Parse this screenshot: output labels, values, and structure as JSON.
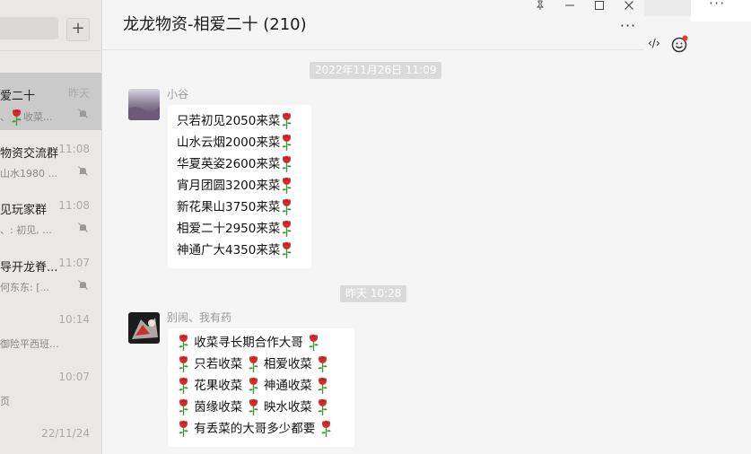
{
  "sidebar": {
    "add_label": "+",
    "conversations": [
      {
        "title": "爱二十",
        "time": "昨天",
        "preview": "收菜...",
        "active": true
      },
      {
        "title": "物资交流群",
        "time": "11:08",
        "preview": "山水1980 ..."
      },
      {
        "title": "见玩家群",
        "time": "11:08",
        "preview": "、: 初见, ..."
      },
      {
        "title": "导开龙脊...",
        "time": "11:07",
        "preview": "何东东: [..."
      },
      {
        "title": "",
        "time": "10:14",
        "preview": "御险平西班..."
      },
      {
        "title": "",
        "time": "10:07",
        "preview": "页"
      },
      {
        "title": "",
        "time": "22/11/24",
        "preview": ""
      }
    ]
  },
  "chat": {
    "title": "龙龙物资-相爱二十 (210)",
    "window_controls": {
      "pin": "⊥",
      "minimize": "—",
      "maximize": "□",
      "close": "✕"
    },
    "more": "···",
    "messages": [
      {
        "time": "2022年11月26日 11:09",
        "sender": "小谷",
        "lines": [
          "只若初见2050来菜",
          "山水云烟2000来菜",
          "华夏英姿2600来菜",
          "宵月团圆3200来菜",
          "新花果山3750来菜",
          "相爱二十2950来菜",
          "神通广大4350来菜"
        ]
      },
      {
        "time": "昨天 10:28",
        "sender": "别闹、我有药",
        "lines": [
          [
            "收菜寻长期合作大哥"
          ],
          [
            "只若收菜",
            "相爱收菜"
          ],
          [
            "花果收菜",
            "神通收菜"
          ],
          [
            "茵缘收菜",
            "映水收菜"
          ],
          [
            "有丢菜的大哥多少都要"
          ]
        ]
      }
    ]
  },
  "right_panel": {
    "more": "···",
    "code_icon": "‹/›"
  },
  "colors": {
    "rose": "#d62b2b",
    "stem": "#3a9a3a",
    "bubble": "#ffffff",
    "background": "#f5f5f5"
  }
}
